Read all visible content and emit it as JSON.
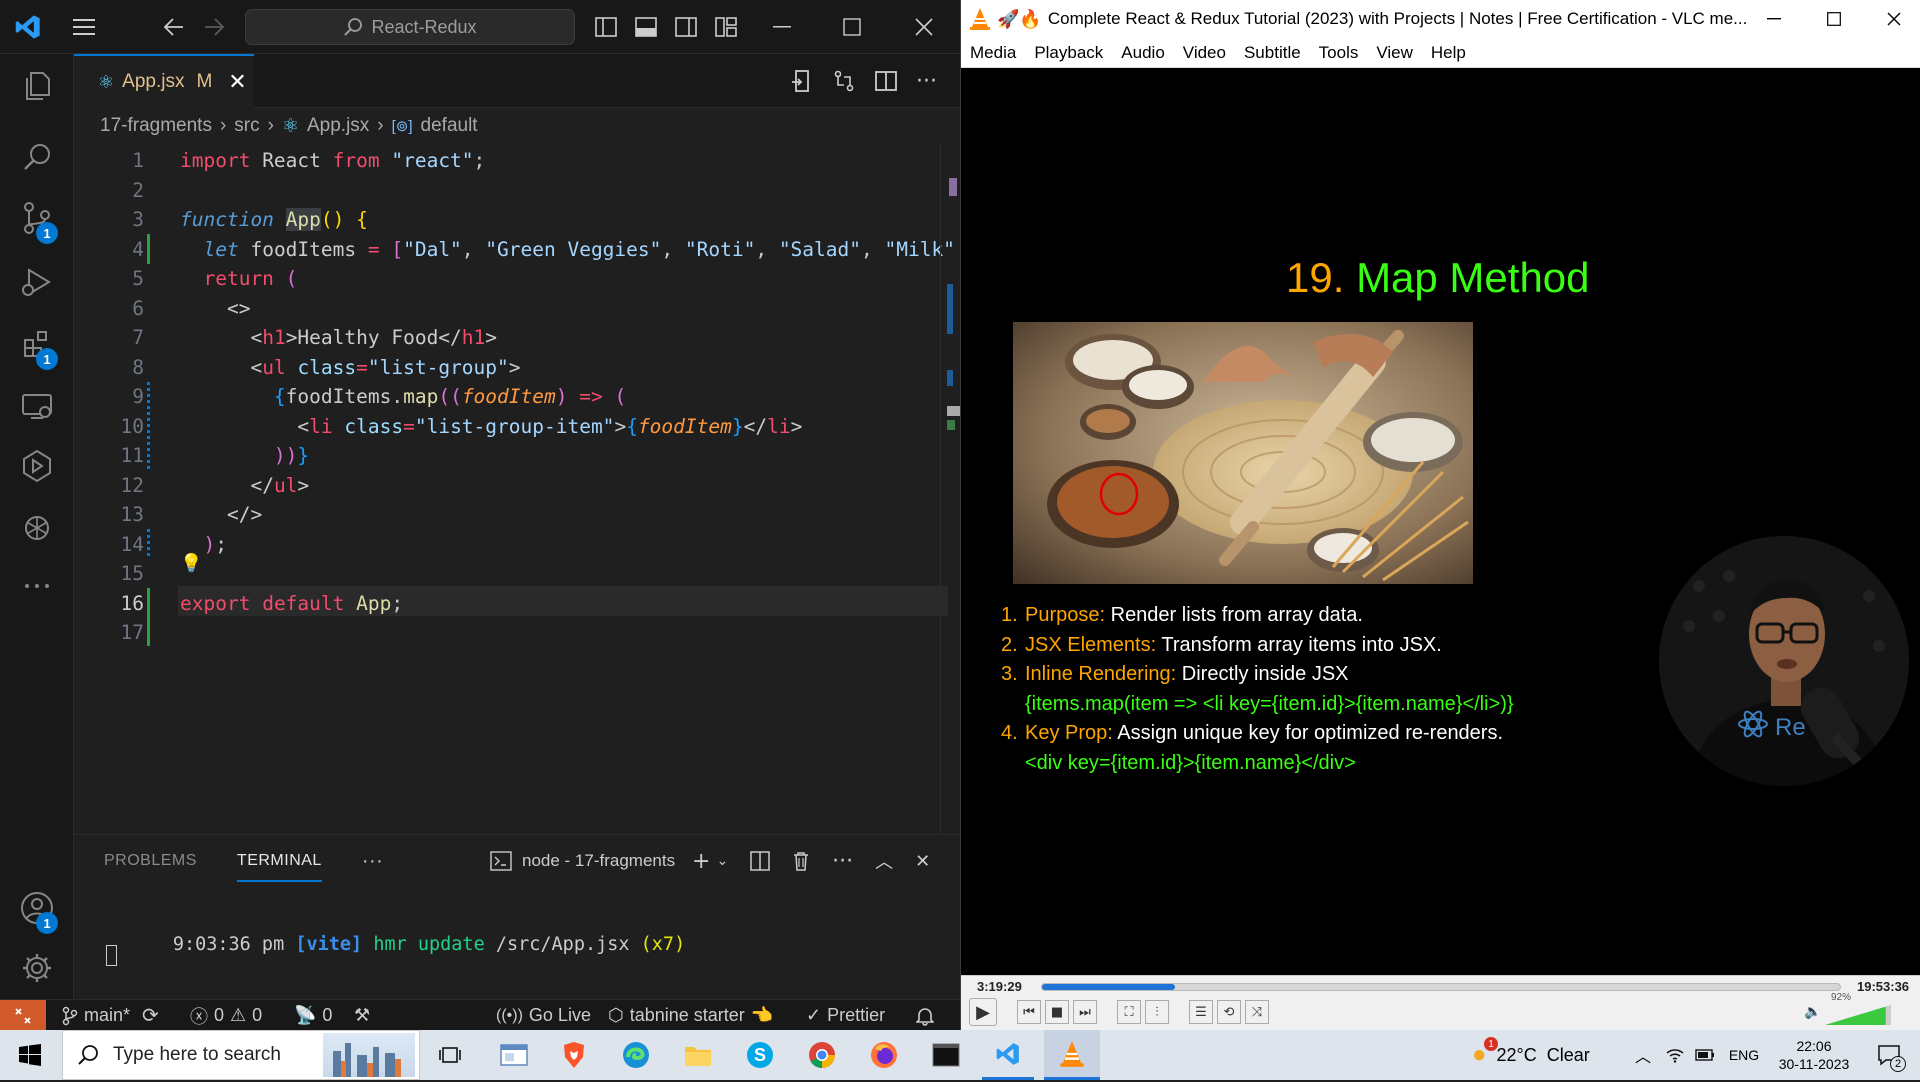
{
  "vscode": {
    "search_text": "React-Redux",
    "tab": {
      "label": "App.jsx",
      "status": "M"
    },
    "breadcrumb": [
      "17-fragments",
      "src",
      "App.jsx",
      "default"
    ],
    "activity_badges": {
      "source_control": "1",
      "extensions": "1",
      "accounts": "1"
    },
    "line_numbers": [
      "1",
      "2",
      "3",
      "4",
      "5",
      "6",
      "7",
      "8",
      "9",
      "10",
      "11",
      "12",
      "13",
      "14",
      "15",
      "16",
      "17"
    ],
    "code": {
      "l1": [
        "import",
        " React ",
        "from",
        " ",
        "\"react\"",
        ";"
      ],
      "l3": [
        "function",
        " ",
        "App",
        "() {"
      ],
      "l4": [
        "let",
        " foodItems ",
        "=",
        " [",
        "\"Dal\"",
        ", ",
        "\"Green Veggies\"",
        ", ",
        "\"Roti\"",
        ", ",
        "\"Salad\"",
        ", ",
        "\"Milk\""
      ],
      "l5": [
        "return",
        " ("
      ],
      "l6": "<>",
      "l7": [
        "<",
        "h1",
        ">Healthy Food</",
        "h1",
        ">"
      ],
      "l8": [
        "<",
        "ul",
        " ",
        "class",
        "=",
        "\"list-group\"",
        ">"
      ],
      "l9": [
        "{",
        "foodItems",
        ".",
        "map",
        "((",
        "foodItem",
        ")",
        " => ",
        "("
      ],
      "l10": [
        "<",
        "li",
        " ",
        "class",
        "=",
        "\"list-group-item\"",
        ">",
        "{",
        "foodItem",
        "}",
        "</",
        "li",
        ">"
      ],
      "l11": [
        "))",
        "}"
      ],
      "l12": [
        "</",
        "ul",
        ">"
      ],
      "l13": "</>",
      "l14": [
        ")",
        ";"
      ],
      "l16": [
        "export",
        " ",
        "default",
        " ",
        "App",
        ";"
      ]
    },
    "panel": {
      "tabs": [
        "PROBLEMS",
        "TERMINAL"
      ],
      "active_tab": "TERMINAL",
      "terminal_name": "node - 17-fragments",
      "terminal_line": {
        "time": "9:03:36 pm",
        "tag": "[vite]",
        "msg1": "hmr update",
        "path": "/src/App.jsx",
        "count": "(x7)"
      }
    },
    "status": {
      "branch": "main*",
      "errors": "0",
      "warnings": "0",
      "ports": "0",
      "go_live": "Go Live",
      "tabnine": "tabnine starter",
      "prettier": "Prettier"
    }
  },
  "vlc": {
    "title": "Complete React & Redux Tutorial (2023) with Projects | Notes | Free Certification - VLC me...",
    "menu": [
      "Media",
      "Playback",
      "Audio",
      "Video",
      "Subtitle",
      "Tools",
      "View",
      "Help"
    ],
    "slide": {
      "title_num": "19.",
      "title_text": "Map Method",
      "items": [
        {
          "n": "1.",
          "key": "Purpose:",
          "text": " Render lists from array data."
        },
        {
          "n": "2.",
          "key": "JSX Elements:",
          "text": " Transform array items into JSX."
        },
        {
          "n": "3.",
          "key": "Inline Rendering:",
          "text": " Directly inside JSX",
          "code": "{items.map(item => <li key={item.id}>{item.name}</li>)}"
        },
        {
          "n": "4.",
          "key": "Key Prop:",
          "text": " Assign unique key for optimized re-renders.",
          "code": "<div key={item.id}>{item.name}</div>"
        }
      ],
      "webcam_text": "Re"
    },
    "time_elapsed": "3:19:29",
    "time_total": "19:53:36",
    "progress": 0.167,
    "volume": "92%",
    "volume_level": 0.92
  },
  "taskbar": {
    "search_placeholder": "Type here to search",
    "weather": "22°C  Clear",
    "weather_badge": "1",
    "lang": "ENG",
    "time": "22:06",
    "date": "30-11-2023",
    "notif_count": "2"
  },
  "colors": {
    "vscode_blue": "#0078d4",
    "keyword": "#f14c6c",
    "vlc_orange": "#ff8800",
    "slide_green": "#39ff14",
    "slide_orange": "#ffa500"
  }
}
